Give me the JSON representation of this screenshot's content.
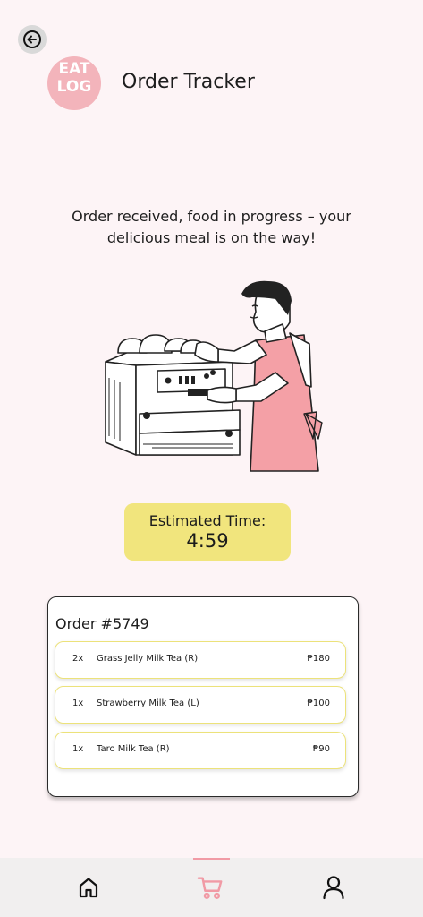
{
  "header": {
    "title": "Order Tracker",
    "logo_line1": "EAT",
    "logo_line2": "LOG"
  },
  "status": {
    "message": "Order received, food in progress – your delicious meal is on the way!"
  },
  "eta": {
    "label": "Estimated Time:",
    "value": "4:59"
  },
  "order": {
    "title": "Order #5749",
    "items": [
      {
        "qty": "2x",
        "name": "Grass Jelly Milk Tea (R)",
        "price": "₱180"
      },
      {
        "qty": "1x",
        "name": "Strawberry Milk Tea (L)",
        "price": "₱100"
      },
      {
        "qty": "1x",
        "name": "Taro Milk Tea (R)",
        "price": "₱90"
      }
    ]
  },
  "nav": {
    "items": [
      {
        "icon": "home-icon"
      },
      {
        "icon": "cart-icon",
        "active": true
      },
      {
        "icon": "profile-icon"
      }
    ]
  },
  "colors": {
    "background": "#fdf4f6",
    "accent_pink": "#f19aa5",
    "accent_yellow": "#f1e57d",
    "item_border": "#ece27a"
  }
}
